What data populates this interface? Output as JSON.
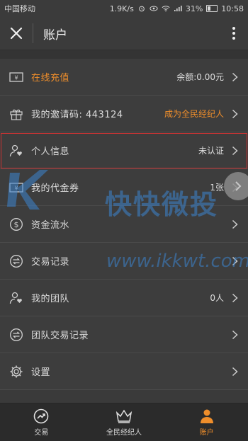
{
  "status": {
    "carrier": "中国移动",
    "net_speed": "1.9K/s",
    "battery": "31%",
    "time": "10:58"
  },
  "header": {
    "title": "账户"
  },
  "rows": [
    {
      "label": "在线充值",
      "value": "余额:0.00元"
    },
    {
      "label": "我的邀请码: 443124",
      "value": "成为全民经纪人"
    },
    {
      "label": "个人信息",
      "value": "未认证"
    },
    {
      "label": "我的代金券",
      "value": "1张"
    },
    {
      "label": "资金流水",
      "value": ""
    },
    {
      "label": "交易记录",
      "value": ""
    },
    {
      "label": "我的团队",
      "value": "0人"
    },
    {
      "label": "团队交易记录",
      "value": ""
    },
    {
      "label": "设置",
      "value": ""
    }
  ],
  "nav": [
    {
      "label": "交易"
    },
    {
      "label": "全民经纪人"
    },
    {
      "label": "账户"
    }
  ],
  "watermark": {
    "text": "快快微投",
    "url": "www.ikkwt.com"
  },
  "colors": {
    "accent": "#ef8e2b",
    "background": "#3a3a3a",
    "watermark": "#3c84d0",
    "highlight": "#cc3333"
  }
}
